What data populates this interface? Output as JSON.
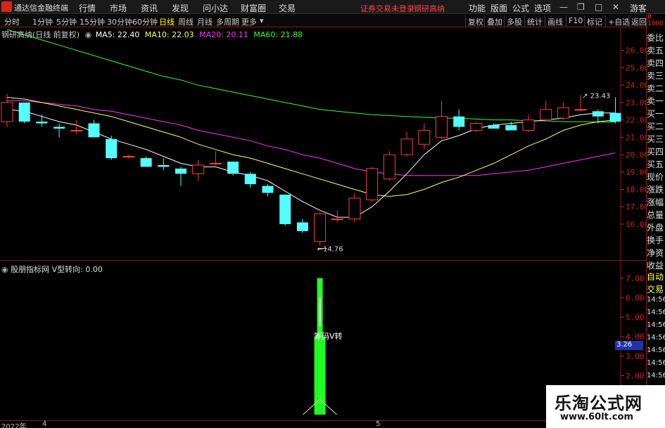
{
  "menubar": {
    "app_name": "通达信金融终端",
    "items": [
      "行情",
      "市场",
      "资讯",
      "发现",
      "问小达",
      "财富圈",
      "交易"
    ],
    "notice_1": "证券交易未登录",
    "notice_2": "钢研高纳",
    "right_items": [
      "功能",
      "版面",
      "公式",
      "选项"
    ],
    "user": "游客"
  },
  "toolbar": {
    "periods": [
      "分时",
      "1分钟",
      "5分钟",
      "15分钟",
      "30分钟",
      "60分钟",
      "日线",
      "周线",
      "月线",
      "多周期",
      "更多"
    ],
    "active_period": "日线",
    "right_buttons": [
      "复权",
      "叠加",
      "多股",
      "统计",
      "画线",
      "F10",
      "标记",
      "+自选",
      "返回"
    ]
  },
  "main_chart": {
    "legend_title": "钢研高纳(日线 前复权)",
    "ma5": "MA5: 22.40",
    "ma10": "MA10: 22.03",
    "ma20": "MA20: 20.11",
    "ma60": "MA60: 21.88",
    "high_label": "23.43",
    "low_label": "14.76",
    "price_ticks": [
      "26.00",
      "25.00",
      "24.00",
      "23.00",
      "22.00",
      "21.00",
      "20.00",
      "19.00",
      "18.00",
      "17.00",
      "16.00"
    ]
  },
  "indicator_chart": {
    "legend": "股朋指标网 V型转向: 0.00",
    "annotation": "筹码V转",
    "ticks": [
      "7.00",
      "6.00",
      "5.00",
      "4.00",
      "3.00",
      "2.00",
      "1.00"
    ],
    "value_box": "3.26"
  },
  "date_axis": {
    "year_label": "2022年",
    "month_4": "4",
    "month_5": "5"
  },
  "right_panel": {
    "top": "委比",
    "items": [
      "卖五",
      "卖四",
      "卖三",
      "卖二",
      "卖一",
      "买一",
      "买二",
      "买三",
      "买四",
      "买五",
      "现价",
      "涨跌",
      "涨幅",
      "总量",
      "外盘",
      "换手",
      "净资",
      "收益"
    ],
    "bottom_items": [
      "自动",
      "交易",
      "14:56",
      "14:56",
      "14:56",
      "14:56",
      "14:56",
      "14:56",
      "14:56",
      "14:56",
      "14:56",
      "14:56"
    ],
    "mini_top": "R",
    "mini_sub": "1000"
  },
  "watermark": {
    "title": "乐淘公式网",
    "url": "www.60lt.com"
  },
  "colors": {
    "up": "#ff3b3b",
    "down": "#54ffff",
    "ma5": "#ffffff",
    "ma10": "#ffff66",
    "ma20": "#ff33ff",
    "ma60": "#33ff33",
    "axis": "#d02020",
    "indicator_bar": "#22ff22"
  },
  "chart_data": {
    "type": "candlestick",
    "candles": [
      {
        "o": 21.9,
        "h": 23.5,
        "l": 21.6,
        "c": 23.0
      },
      {
        "o": 23.0,
        "h": 23.0,
        "l": 21.8,
        "c": 21.9
      },
      {
        "o": 21.9,
        "h": 22.3,
        "l": 21.6,
        "c": 21.8
      },
      {
        "o": 21.6,
        "h": 21.8,
        "l": 21.0,
        "c": 21.5
      },
      {
        "o": 21.4,
        "h": 22.0,
        "l": 21.2,
        "c": 21.4
      },
      {
        "o": 21.8,
        "h": 22.0,
        "l": 21.0,
        "c": 21.0
      },
      {
        "o": 20.9,
        "h": 21.1,
        "l": 19.7,
        "c": 19.8
      },
      {
        "o": 19.9,
        "h": 20.0,
        "l": 19.8,
        "c": 19.9
      },
      {
        "o": 19.8,
        "h": 19.9,
        "l": 19.3,
        "c": 19.3
      },
      {
        "o": 19.4,
        "h": 19.8,
        "l": 19.1,
        "c": 19.3
      },
      {
        "o": 19.2,
        "h": 19.3,
        "l": 18.2,
        "c": 18.9
      },
      {
        "o": 18.9,
        "h": 19.7,
        "l": 18.5,
        "c": 19.4
      },
      {
        "o": 19.5,
        "h": 20.2,
        "l": 19.4,
        "c": 19.5
      },
      {
        "o": 19.6,
        "h": 19.6,
        "l": 18.8,
        "c": 18.9
      },
      {
        "o": 18.9,
        "h": 19.0,
        "l": 18.1,
        "c": 18.3
      },
      {
        "o": 18.2,
        "h": 18.3,
        "l": 17.6,
        "c": 17.8
      },
      {
        "o": 17.7,
        "h": 17.7,
        "l": 15.9,
        "c": 16.0
      },
      {
        "o": 16.1,
        "h": 16.3,
        "l": 15.5,
        "c": 15.6
      },
      {
        "o": 15.0,
        "h": 16.7,
        "l": 14.76,
        "c": 16.6
      },
      {
        "o": 16.3,
        "h": 16.8,
        "l": 16.1,
        "c": 16.3
      },
      {
        "o": 16.3,
        "h": 17.8,
        "l": 16.1,
        "c": 17.5
      },
      {
        "o": 17.4,
        "h": 19.3,
        "l": 17.3,
        "c": 19.2
      },
      {
        "o": 18.6,
        "h": 20.2,
        "l": 18.5,
        "c": 20.0
      },
      {
        "o": 20.0,
        "h": 21.3,
        "l": 19.9,
        "c": 20.9
      },
      {
        "o": 20.6,
        "h": 21.8,
        "l": 20.3,
        "c": 21.4
      },
      {
        "o": 21.0,
        "h": 23.1,
        "l": 20.9,
        "c": 22.2
      },
      {
        "o": 22.2,
        "h": 22.6,
        "l": 21.4,
        "c": 21.6
      },
      {
        "o": 21.4,
        "h": 21.9,
        "l": 21.3,
        "c": 21.8
      },
      {
        "o": 21.7,
        "h": 21.8,
        "l": 21.5,
        "c": 21.5
      },
      {
        "o": 21.7,
        "h": 21.9,
        "l": 21.4,
        "c": 21.4
      },
      {
        "o": 21.4,
        "h": 22.3,
        "l": 21.3,
        "c": 22.0
      },
      {
        "o": 22.0,
        "h": 23.1,
        "l": 21.9,
        "c": 22.6
      },
      {
        "o": 22.1,
        "h": 23.0,
        "l": 22.0,
        "c": 22.7
      },
      {
        "o": 22.6,
        "h": 23.43,
        "l": 22.5,
        "c": 22.6
      },
      {
        "o": 22.5,
        "h": 22.6,
        "l": 21.8,
        "c": 22.2
      },
      {
        "o": 22.4,
        "h": 23.3,
        "l": 21.8,
        "c": 21.9
      }
    ],
    "ma5": [
      22.6,
      22.5,
      22.2,
      21.9,
      21.7,
      21.3,
      20.9,
      20.6,
      20.3,
      19.9,
      19.5,
      19.3,
      19.3,
      19.0,
      18.8,
      18.5,
      17.9,
      17.3,
      16.8,
      16.4,
      16.4,
      17.0,
      17.9,
      18.9,
      20.0,
      20.8,
      21.1,
      21.5,
      21.7,
      21.8,
      21.9,
      22.0,
      22.1,
      22.3,
      22.4,
      22.4
    ],
    "ma10": [
      23.3,
      23.2,
      23.0,
      22.8,
      22.6,
      22.4,
      22.2,
      21.9,
      21.6,
      21.3,
      21.0,
      20.6,
      20.3,
      20.0,
      19.8,
      19.5,
      19.2,
      18.9,
      18.6,
      18.3,
      18.0,
      17.7,
      17.6,
      17.7,
      18.0,
      18.4,
      18.7,
      19.1,
      19.5,
      20.0,
      20.5,
      20.9,
      21.4,
      21.7,
      21.9,
      22.0
    ],
    "ma20": [
      23.1,
      23.1,
      23.0,
      22.9,
      22.8,
      22.6,
      22.5,
      22.3,
      22.1,
      21.9,
      21.7,
      21.4,
      21.2,
      21.0,
      20.8,
      20.5,
      20.3,
      20.0,
      19.8,
      19.5,
      19.2,
      19.0,
      18.9,
      18.8,
      18.8,
      18.8,
      18.8,
      18.8,
      18.9,
      19.0,
      19.1,
      19.3,
      19.5,
      19.7,
      19.9,
      20.1
    ],
    "ma60": [
      27.2,
      26.9,
      26.6,
      26.3,
      26.0,
      25.7,
      25.4,
      25.1,
      24.8,
      24.5,
      24.3,
      24.0,
      23.8,
      23.6,
      23.4,
      23.2,
      23.0,
      22.8,
      22.6,
      22.5,
      22.4,
      22.3,
      22.25,
      22.2,
      22.15,
      22.1,
      22.1,
      22.05,
      22.0,
      22.0,
      21.95,
      21.95,
      21.9,
      21.9,
      21.88,
      21.88
    ],
    "y_range": [
      14.3,
      27.0
    ],
    "indicator": {
      "name": "V型转向",
      "bar_index": 18,
      "bar_value": 7.0,
      "y_range": [
        0,
        7.5
      ]
    }
  }
}
